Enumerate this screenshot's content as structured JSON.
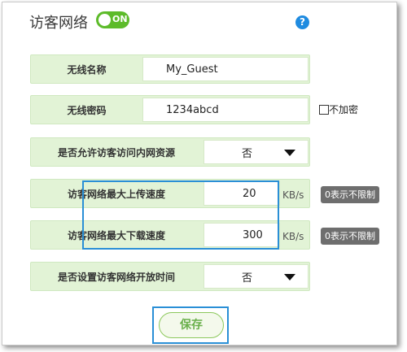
{
  "header": {
    "title": "访客网络",
    "toggle_state": "ON",
    "help_label": "?"
  },
  "form": {
    "ssid": {
      "label": "无线名称",
      "value": "My_Guest"
    },
    "password": {
      "label": "无线密码",
      "value": "1234abcd",
      "no_encrypt_label": "不加密"
    },
    "allow_lan": {
      "label": "是否允许访客访问内网资源",
      "value": "否"
    },
    "upload": {
      "label": "访客网络最大上传速度",
      "value": "20",
      "unit": "KB/s",
      "hint": "0表示不限制"
    },
    "download": {
      "label": "访客网络最大下载速度",
      "value": "300",
      "unit": "KB/s",
      "hint": "0表示不限制"
    },
    "schedule": {
      "label": "是否设置访客网络开放时间",
      "value": "否"
    }
  },
  "actions": {
    "save_label": "保存"
  },
  "colors": {
    "accent_green": "#5dbb2a",
    "highlight_blue": "#2a8fd6",
    "row_bg": "#e2f3d6"
  }
}
